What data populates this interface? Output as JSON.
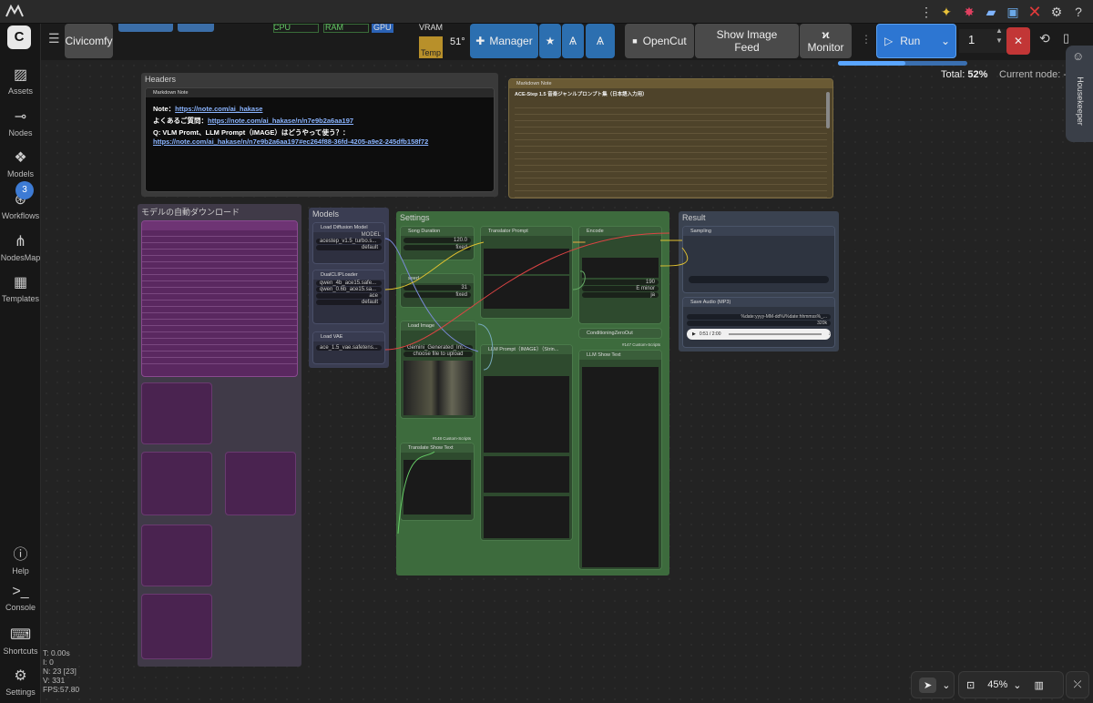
{
  "app": {
    "name": "Civicomfy"
  },
  "osbar": {
    "icons": [
      "comfy-logo-icon",
      "dots-icon",
      "sparkle-icon",
      "burst-icon",
      "pill-icon",
      "monitor-icon",
      "close-x-icon",
      "gear-icon",
      "question-icon"
    ]
  },
  "sidebar": {
    "items": [
      {
        "label": "Assets",
        "icon": "image-icon"
      },
      {
        "label": "Nodes",
        "icon": "node-icon"
      },
      {
        "label": "Models",
        "icon": "cube-icon"
      },
      {
        "label": "Workflows",
        "icon": "workflow-icon",
        "badge": "3"
      },
      {
        "label": "NodesMap",
        "icon": "map-icon"
      },
      {
        "label": "Templates",
        "icon": "template-icon"
      }
    ],
    "bottom": [
      {
        "label": "Help",
        "icon": "help-icon"
      },
      {
        "label": "Console",
        "icon": "terminal-icon"
      },
      {
        "label": "Shortcuts",
        "icon": "keyboard-icon"
      },
      {
        "label": "Settings",
        "icon": "settings-icon"
      }
    ]
  },
  "toolbar": {
    "civicomfy": "Civicomfy",
    "cpu": "CPU",
    "ram": "RAM",
    "gpu": "GPU",
    "vram": "VRAM",
    "temp": "Temp",
    "temp_value": "51°",
    "manager": "Manager",
    "opencut": "OpenCut",
    "show_image_feed_1": "Show Image",
    "show_image_feed_2": "Feed",
    "monitor": "Monitor",
    "run": "Run",
    "queue_count": "1",
    "total_label": "Total:",
    "total_value": "52%",
    "current_node": "Current node: -",
    "housekeeper": "Housekeeper",
    "progress": 0.52
  },
  "groups": {
    "headers": "Headers",
    "download": "モデルの自動ダウンロード",
    "models": "Models",
    "settings": "Settings",
    "result": "Result"
  },
  "notes": {
    "note1_title": "Markdown Note",
    "note1_line1_label": "Note：",
    "note1_line1_link": "https://note.com/ai_hakase",
    "note1_line2_label": "よくあるご質問：",
    "note1_line2_link": "https://note.com/ai_hakase/n/n7e9b2a6aa197",
    "note1_line3": "Q: VLM Promt、LLM Prompt（IMAGE）はどうやって使う？：",
    "note1_line4_link": "https://note.com/ai_hakase/n/n7e9b2a6aa197#ec264f88-36fd-4205-a9e2-245dfb158f72",
    "note2_title": "Markdown Note",
    "note2_heading": "ACE-Step 1.5 音楽ジャンルプロンプト集（日本語入力用）"
  },
  "nodes": {
    "load_diffusion": "Load Diffusion Model",
    "model_label": "MODEL",
    "unet_name": "acestep_v1.5_turbo.s...",
    "weight_dtype": "default",
    "dualclip": "DualCLIPLoader",
    "clip1": "qwen_4b_ace15.safe...",
    "clip2": "qwen_0.6b_ace15.sa...",
    "clip_type": "ace",
    "device": "default",
    "load_vae": "Load VAE",
    "vae_name": "ace_1.5_vae.safetens...",
    "song_duration": "Song Duration",
    "duration_value": "120.0",
    "control_after": "fixed",
    "seed": "seed",
    "seed_value": "31",
    "translator": "Translator Prompt",
    "encode": "Encode",
    "bpm": "190",
    "keyscale": "E minor",
    "language": "ja",
    "load_image": "Load Image",
    "image_file": "Gemini_Generated_Im...",
    "choose_file": "choose file to upload",
    "llm_prompt": "LLM Prompt（IMAGE）（Strin...",
    "llm_show": "LLM Show Text",
    "tshow": "Translate Show Text",
    "sampling": "Sampling",
    "save_audio": "Save Audio (MP3)",
    "filename_prefix": "%date:yyyy-MM-dd%/%date:hhmmss%_...",
    "quality": "320k",
    "audio_time": "0:51 / 2:00",
    "conditioning_zero": "ConditioningZeroOut",
    "custom_scripts_148": "#148 Custom-Scripts",
    "custom_scripts_147": "#147 Custom-Scripts"
  },
  "stats": {
    "t": "T: 0.00s",
    "i": "I: 0",
    "n": "N: 23 [23]",
    "v": "V: 331",
    "fps": "FPS:57.80"
  },
  "bottom_controls": {
    "zoom": "45%"
  }
}
